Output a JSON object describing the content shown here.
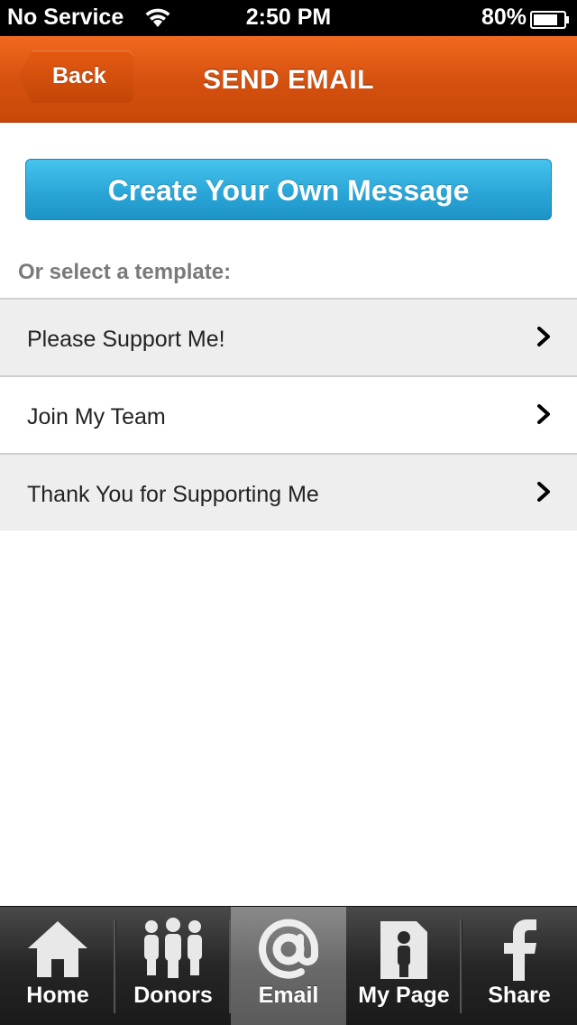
{
  "status_bar": {
    "carrier": "No Service",
    "time": "2:50 PM",
    "battery": "80%",
    "battery_level": 0.8
  },
  "header": {
    "back_label": "Back",
    "title": "SEND EMAIL",
    "accent_color": "#e05a12"
  },
  "main": {
    "create_button_label": "Create Your Own Message",
    "template_prompt": "Or select a template:",
    "templates": [
      {
        "label": "Please Support Me!"
      },
      {
        "label": "Join My Team"
      },
      {
        "label": "Thank You for Supporting Me"
      }
    ]
  },
  "tab_bar": {
    "tabs": [
      {
        "label": "Home",
        "icon": "home-icon"
      },
      {
        "label": "Donors",
        "icon": "donors-icon"
      },
      {
        "label": "Email",
        "icon": "at-sign-icon",
        "active": true
      },
      {
        "label": "My Page",
        "icon": "my-page-icon"
      },
      {
        "label": "Share",
        "icon": "facebook-icon"
      }
    ]
  }
}
